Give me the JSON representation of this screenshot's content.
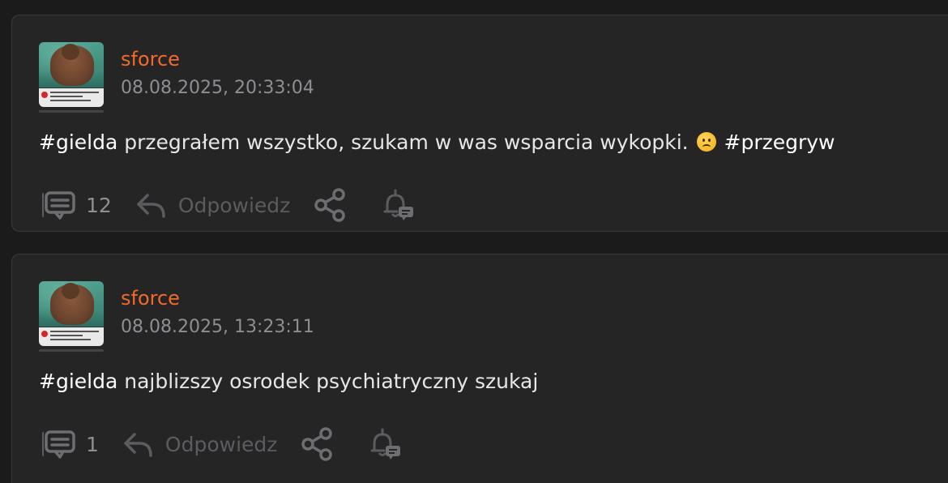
{
  "posts": [
    {
      "username": "sforce",
      "timestamp": "08.08.2025, 20:33:04",
      "tag": "#gielda",
      "text": " przegrałem wszystko, szukam w was wsparcia wykopki. ",
      "emoji": "slightly-frowning-face",
      "trailing_tag": "#przegryw",
      "comments_count": "12",
      "reply_label": "Odpowiedz"
    },
    {
      "username": "sforce",
      "timestamp": "08.08.2025, 13:23:11",
      "tag": "#gielda",
      "text": " najblizszy osrodek psychiatryczny szukaj",
      "comments_count": "1",
      "reply_label": "Odpowiedz"
    }
  ],
  "colors": {
    "background": "#1b1b1c",
    "card": "#252526",
    "username": "#f26a2a",
    "timestamp": "#8e8e93",
    "text": "#e6e6e6",
    "action": "#6e6e72"
  },
  "icons": {
    "comments": "comment-icon",
    "reply": "reply-arrow-icon",
    "share": "share-icon",
    "notify": "bell-icon"
  }
}
